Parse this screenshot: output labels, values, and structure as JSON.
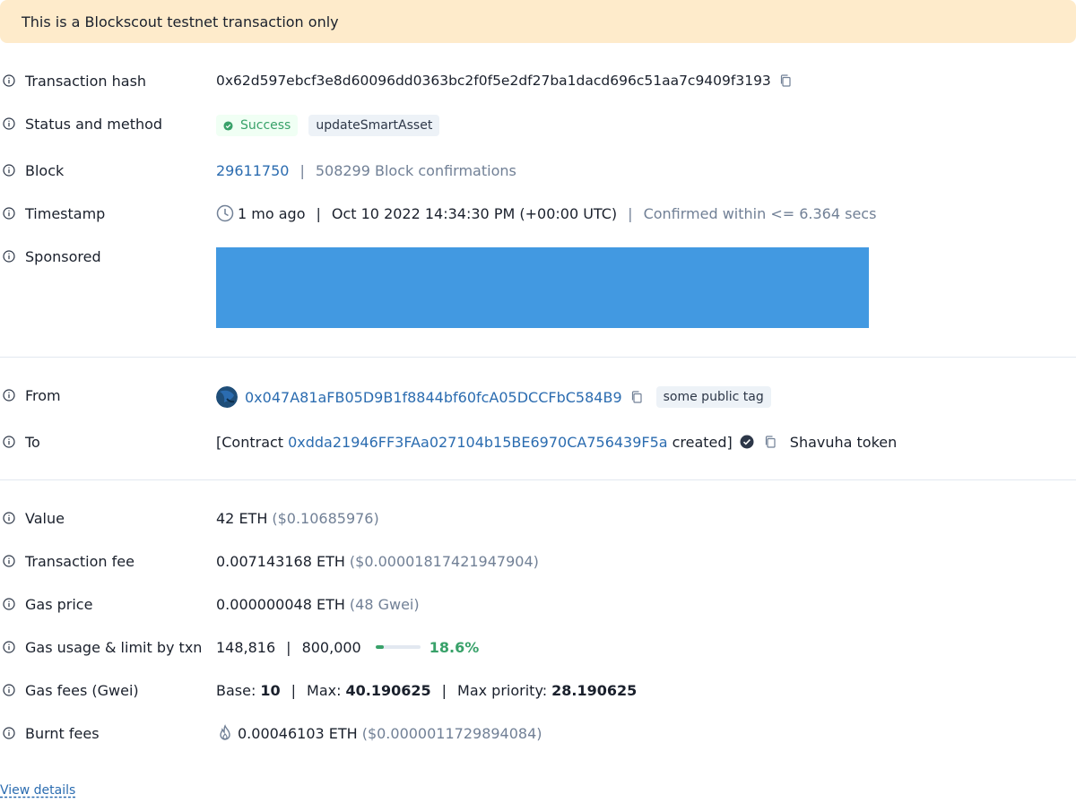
{
  "banner": {
    "text": "This is a Blockscout testnet transaction only"
  },
  "tx_hash": {
    "label": "Transaction hash",
    "value": "0x62d597ebcf3e8d60096dd0363bc2f0f5e2df27ba1dacd696c51aa7c9409f3193"
  },
  "status": {
    "label": "Status and method",
    "status": "Success",
    "method": "updateSmartAsset"
  },
  "block": {
    "label": "Block",
    "number": "29611750",
    "separator": "|",
    "confirmations": "508299 Block confirmations"
  },
  "timestamp": {
    "label": "Timestamp",
    "relative": "1 mo ago",
    "separator": "|",
    "absolute": "Oct 10 2022 14:34:30 PM (+00:00 UTC)",
    "confirmed": "Confirmed within <= 6.364 secs"
  },
  "sponsored": {
    "label": "Sponsored",
    "color": "#4299E1"
  },
  "from": {
    "label": "From",
    "address": "0x047A81aFB05D9B1f8844bf60fcA05DCCFbC584B9",
    "tag": "some public tag"
  },
  "to": {
    "label": "To",
    "prefix": "[Contract",
    "address": "0xdda21946FF3FAa027104b15BE6970CA756439F5a",
    "suffix": "created]",
    "token": "Shavuha token"
  },
  "value": {
    "label": "Value",
    "amount": "42 ETH",
    "usd": "($0.10685976)"
  },
  "fee": {
    "label": "Transaction fee",
    "amount": "0.007143168 ETH",
    "usd": "($0.00001817421947904)"
  },
  "gas_price": {
    "label": "Gas price",
    "amount": "0.000000048 ETH",
    "gwei": "(48 Gwei)"
  },
  "gas_usage": {
    "label": "Gas usage & limit by txn",
    "used": "148,816",
    "separator": "|",
    "limit": "800,000",
    "percent": "18.6%",
    "fraction": 0.186
  },
  "gas_fees": {
    "label": "Gas fees (Gwei)",
    "base_label": "Base:",
    "base": "10",
    "max_label": "Max:",
    "max": "40.190625",
    "priority_label": "Max priority:",
    "priority": "28.190625"
  },
  "burnt": {
    "label": "Burnt fees",
    "amount": "0.00046103 ETH",
    "usd": "($0.0000011729894084)"
  },
  "view_details": "View details",
  "colors": {
    "link": "#2B6CB0",
    "success": "#38A169",
    "banner_bg": "#FEEBCB",
    "muted": "#718096"
  }
}
